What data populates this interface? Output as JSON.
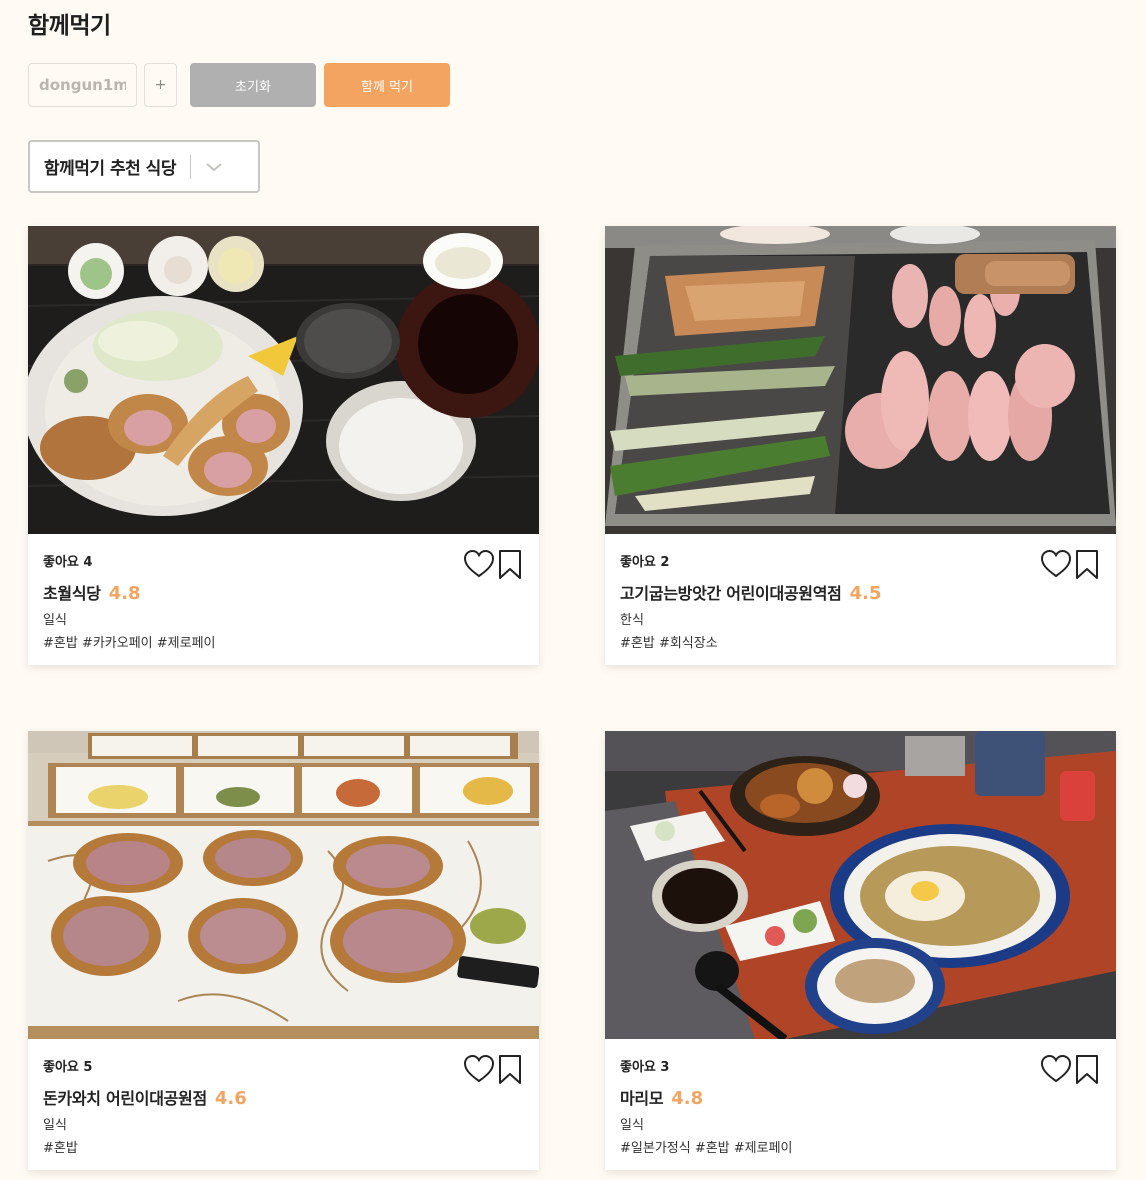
{
  "page": {
    "title": "함께먹기"
  },
  "controls": {
    "name_value": "dongun1m",
    "plus_label": "+",
    "reset_label": "초기화",
    "together_label": "함께 먹기"
  },
  "dropdown": {
    "selected": "함께먹기 추천 식당"
  },
  "restaurants": [
    {
      "likes": "좋아요 4",
      "name": "초월식당",
      "rating": "4.8",
      "category": "일식",
      "tags": "#혼밥 #카카오페이 #제로페이",
      "photo_icon": "tonkatsu-set-photo"
    },
    {
      "likes": "좋아요 2",
      "name": "고기굽는방앗간 어린이대공원역점",
      "rating": "4.5",
      "category": "한식",
      "tags": "#혼밥 #회식장소",
      "photo_icon": "pork-grill-photo"
    },
    {
      "likes": "좋아요 5",
      "name": "돈카와치 어린이대공원점",
      "rating": "4.6",
      "category": "일식",
      "tags": "#혼밥",
      "photo_icon": "tonkatsu-plate-photo"
    },
    {
      "likes": "좋아요 3",
      "name": "마리모",
      "rating": "4.8",
      "category": "일식",
      "tags": "#일본가정식 #혼밥 #제로페이",
      "photo_icon": "ramen-set-photo"
    }
  ],
  "colors": {
    "accent": "#f3a461",
    "reset": "#b0b0b0",
    "background": "#fffbf4"
  }
}
